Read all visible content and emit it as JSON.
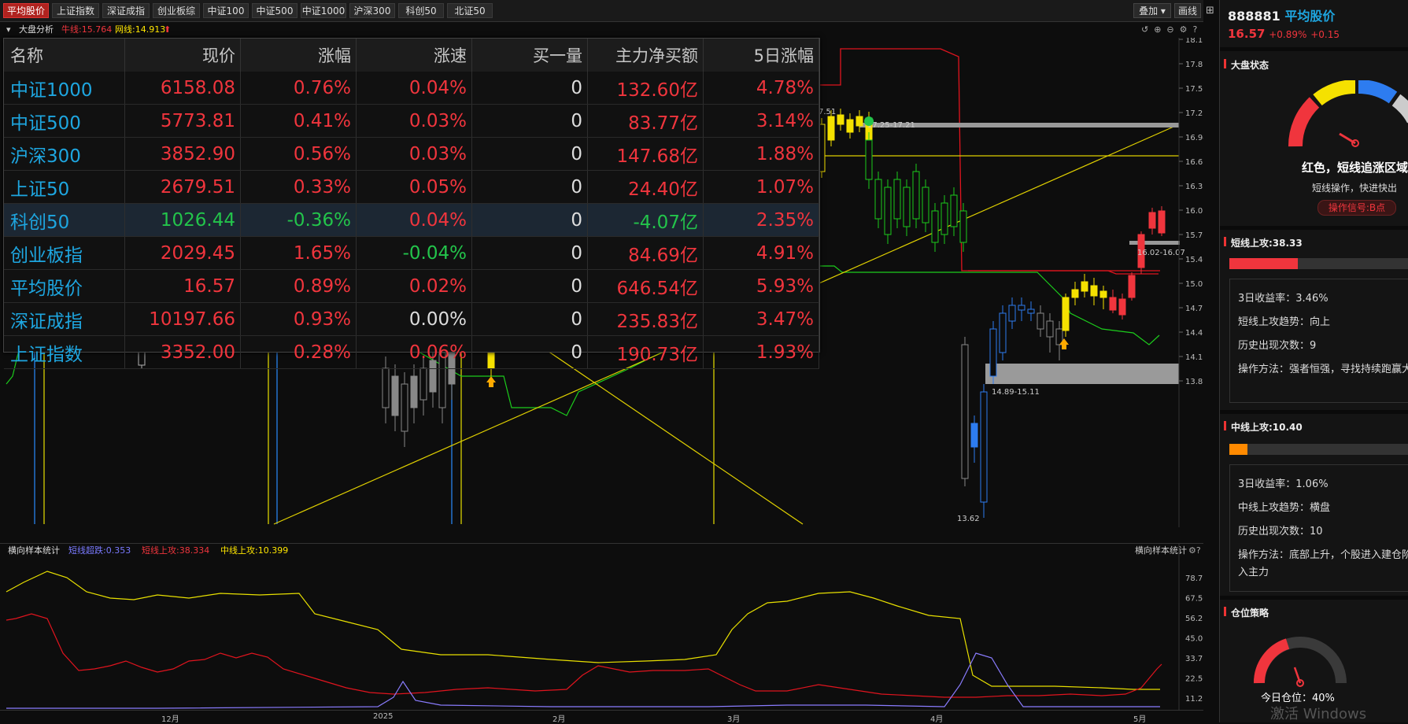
{
  "tabs": [
    "平均股价",
    "上证指数",
    "深证成指",
    "创业板综",
    "中证100",
    "中证500",
    "中证1000",
    "沪深300",
    "科创50",
    "北证50"
  ],
  "active_tab": 0,
  "toolbar": {
    "overlay_label": "叠加",
    "draw_label": "画线"
  },
  "subheader": {
    "title": "大盘分析",
    "bull_label": "牛线:15.764",
    "net_label": "网线:14.913"
  },
  "main_y_ticks": [
    "18.17",
    "17.86",
    "17.55",
    "17.25",
    "16.94",
    "16.63",
    "16.32",
    "16.01",
    "15.70",
    "15.40",
    "15.09",
    "14.78",
    "14.47",
    "14.16",
    "13.85"
  ],
  "main_labels": {
    "t1": "7.51",
    "t2": "17.25-17.21",
    "zone1": "16.02-16.07",
    "zone2": "14.89-15.11",
    "low": "13.62"
  },
  "lower_header": {
    "title": "横向样本统计",
    "s1": "短线超跌:0.353",
    "s2": "短线上攻:38.334",
    "s3": "中线上攻:10.399",
    "right_title": "横向样本统计"
  },
  "lower_y_ticks": [
    "78.75",
    "67.50",
    "56.25",
    "45.00",
    "33.75",
    "22.50",
    "11.25"
  ],
  "x_labels": [
    "12月",
    "2025",
    "2月",
    "3月",
    "4月",
    "5月"
  ],
  "index_table": {
    "headers": [
      "名称",
      "现价",
      "涨幅",
      "涨速",
      "买一量",
      "主力净买额",
      "5日涨幅"
    ],
    "rows": [
      {
        "name": "中证1000",
        "price": "6158.08",
        "chg": "0.76%",
        "speed": "0.04%",
        "bid": "0",
        "net": "132.60亿",
        "five": "4.78%"
      },
      {
        "name": "中证500",
        "price": "5773.81",
        "chg": "0.41%",
        "speed": "0.03%",
        "bid": "0",
        "net": "83.77亿",
        "five": "3.14%"
      },
      {
        "name": "沪深300",
        "price": "3852.90",
        "chg": "0.56%",
        "speed": "0.03%",
        "bid": "0",
        "net": "147.68亿",
        "five": "1.88%"
      },
      {
        "name": "上证50",
        "price": "2679.51",
        "chg": "0.33%",
        "speed": "0.05%",
        "bid": "0",
        "net": "24.40亿",
        "five": "1.07%"
      },
      {
        "name": "科创50",
        "price": "1026.44",
        "chg": "-0.36%",
        "speed": "0.04%",
        "bid": "0",
        "net": "-4.07亿",
        "five": "2.35%"
      },
      {
        "name": "创业板指",
        "price": "2029.45",
        "chg": "1.65%",
        "speed": "-0.04%",
        "bid": "0",
        "net": "84.69亿",
        "five": "4.91%"
      },
      {
        "name": "平均股价",
        "price": "16.57",
        "chg": "0.89%",
        "speed": "0.02%",
        "bid": "0",
        "net": "646.54亿",
        "five": "5.93%"
      },
      {
        "name": "深证成指",
        "price": "10197.66",
        "chg": "0.93%",
        "speed": "0.00%",
        "bid": "0",
        "net": "235.83亿",
        "five": "3.47%"
      },
      {
        "name": "上证指数",
        "price": "3352.00",
        "chg": "0.28%",
        "speed": "0.06%",
        "bid": "0",
        "net": "190.73亿",
        "five": "1.93%"
      }
    ]
  },
  "right_panel": {
    "code": "888881",
    "name": "平均股价",
    "price": "16.57",
    "pct": "+0.89%",
    "chg": "+0.15",
    "market_state_title": "大盘状态",
    "state_text": "红色，短线追涨区域",
    "state_sub": "短线操作，快进快出",
    "signal": "操作信号:B点",
    "short_title": "短线上攻:38.33",
    "short_fill": 0.38,
    "short_lines": [
      "3日收益率：3.46%",
      "短线上攻趋势：向上",
      "历史出现次数：9",
      "操作方法：强者恒强，寻找持续跑赢大"
    ],
    "mid_title": "中线上攻:10.40",
    "mid_fill": 0.1,
    "mid_lines": [
      "3日收益率：1.06%",
      "中线上攻趋势：横盘",
      "历史出现次数：10",
      "操作方法：底部上升，个股进入建仓阶",
      "入主力"
    ],
    "position_title": "仓位策略",
    "position_text": "今日仓位：40%",
    "position_value": 0.4
  },
  "watermark": "激活 Windows"
}
